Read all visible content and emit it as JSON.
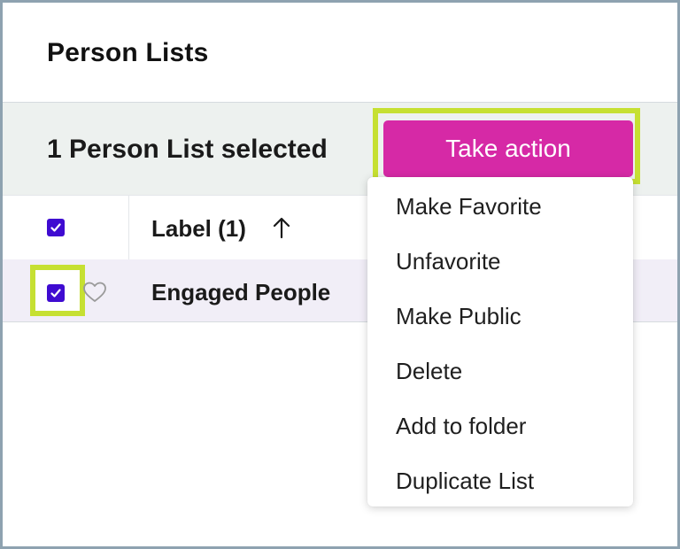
{
  "header": {
    "title": "Person Lists"
  },
  "selection_bar": {
    "status_text": "1 Person List selected",
    "action_button_label": "Take action"
  },
  "table": {
    "columns": [
      {
        "label": "Label (1)",
        "sort": "ascending",
        "sort_icon": "arrow-up-icon"
      }
    ],
    "header_checkbox_checked": true,
    "rows": [
      {
        "label": "Engaged People",
        "checked": true,
        "favorite": false,
        "favorite_icon": "heart-outline-icon"
      }
    ]
  },
  "action_menu": {
    "items": [
      {
        "label": "Make Favorite"
      },
      {
        "label": "Unfavorite"
      },
      {
        "label": "Make Public"
      },
      {
        "label": "Delete"
      },
      {
        "label": "Add to folder"
      },
      {
        "label": "Duplicate List"
      }
    ]
  },
  "colors": {
    "accent": "#d629a6",
    "checkbox": "#3f0bd1",
    "highlight": "#c6e032",
    "selection_bar_bg": "#edf1ef",
    "selected_row_bg": "#f1eef7"
  }
}
